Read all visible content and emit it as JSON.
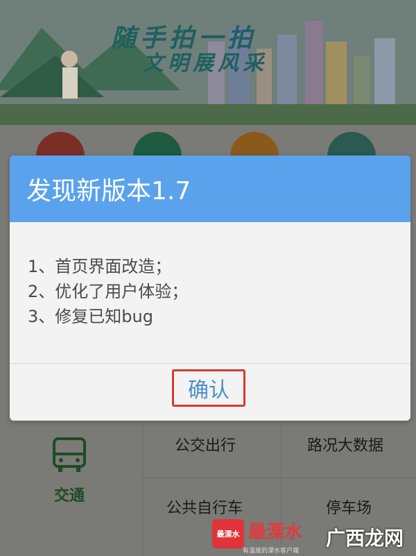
{
  "banner": {
    "line1": "随手拍一拍",
    "line2": "文明展风采"
  },
  "dialog": {
    "title": "发现新版本1.7",
    "changes": [
      "1、首页界面改造；",
      "2、优化了用户体验；",
      "3、修复已知bug"
    ],
    "confirm_label": "确认"
  },
  "background": {
    "transport_label": "交通",
    "services": [
      "公交出行",
      "路况大数据",
      "公共自行车",
      "停车场"
    ]
  },
  "watermark": {
    "badge": "最溧水",
    "text": "最溧水",
    "text2": "广西龙网",
    "sub": "有温度的溧水客户端"
  },
  "colors": {
    "header_blue": "#5aa2ec",
    "confirm_text": "#4a8fc9",
    "highlight_red": "#d63a32",
    "overlay_gray": "#7a7a77"
  }
}
